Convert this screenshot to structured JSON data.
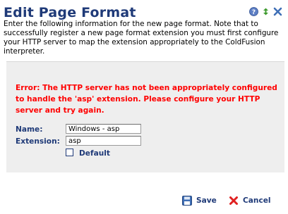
{
  "header": {
    "title": "Edit Page Format",
    "icons": [
      "help-icon",
      "refresh-icon",
      "close-icon"
    ]
  },
  "intro_text": "Enter the following information for the new page format. Note that to successfully register a new page format extension you must first configure your HTTP server to map the extension appropriately to the ColdFusion interpreter.",
  "error_message": "Error: The HTTP server has not been appropriately configured to handle the 'asp' extension. Please configure your HTTP server and try again.",
  "form": {
    "name_label": "Name:",
    "name_value": "Windows - asp",
    "extension_label": "Extension:",
    "extension_value": "asp",
    "default_label": "Default",
    "default_checked": false
  },
  "actions": {
    "save_label": "Save",
    "cancel_label": "Cancel"
  },
  "colors": {
    "title": "#1f3a78",
    "error": "#ff0000",
    "panel": "#eeeeee"
  }
}
